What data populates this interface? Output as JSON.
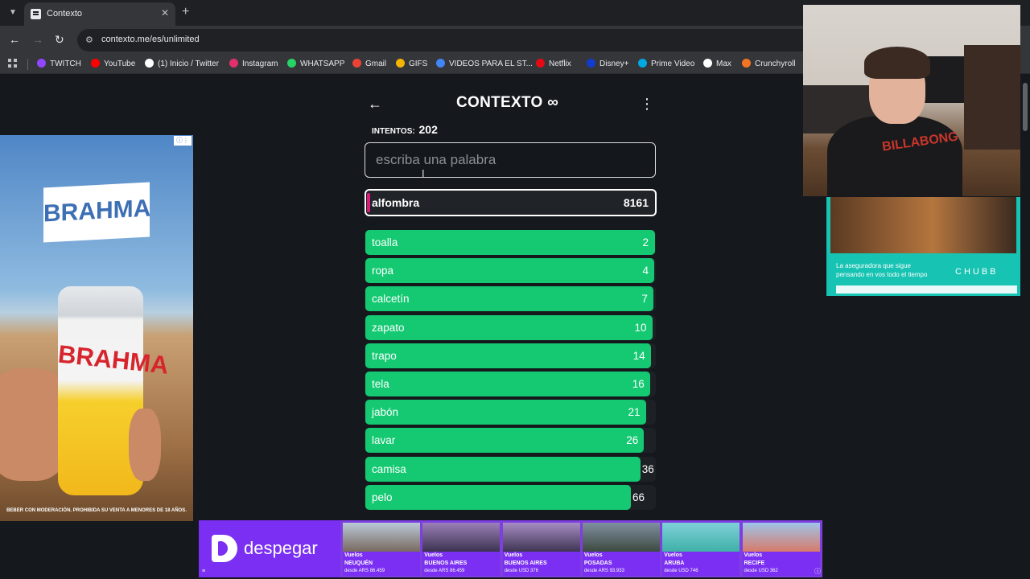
{
  "browser": {
    "tab_title": "Contexto",
    "url": "contexto.me/es/unlimited",
    "bookmarks": [
      {
        "label": "TWITCH",
        "icon": "twitch-icon",
        "color": "#9146ff"
      },
      {
        "label": "YouTube",
        "icon": "youtube-icon",
        "color": "#ff0000"
      },
      {
        "label": "(1) Inicio / Twitter",
        "icon": "x-icon",
        "color": "#ffffff"
      },
      {
        "label": "Instagram",
        "icon": "instagram-icon",
        "color": "#e1306c"
      },
      {
        "label": "WHATSAPP",
        "icon": "whatsapp-icon",
        "color": "#25d366"
      },
      {
        "label": "Gmail",
        "icon": "gmail-icon",
        "color": "#ea4335"
      },
      {
        "label": "GIFS",
        "icon": "gifs-icon",
        "color": "#f4b400"
      },
      {
        "label": "VIDEOS PARA EL ST...",
        "icon": "drive-icon",
        "color": "#4285f4"
      },
      {
        "label": "Netflix",
        "icon": "netflix-icon",
        "color": "#e50914"
      },
      {
        "label": "Disney+",
        "icon": "disney-icon",
        "color": "#113ccf"
      },
      {
        "label": "Prime Video",
        "icon": "prime-video-icon",
        "color": "#00a8e1"
      },
      {
        "label": "Max",
        "icon": "max-icon",
        "color": "#ffffff"
      },
      {
        "label": "Crunchyroll",
        "icon": "crunchyroll-icon",
        "color": "#f47521"
      }
    ]
  },
  "game": {
    "logo": "CONTEXTO ∞",
    "attempts_label": "INTENTOS:",
    "attempts_count": "202",
    "input_placeholder": "escriba una palabra",
    "current_guess": {
      "word": "alfombra",
      "rank": "8161"
    },
    "accent_color": "#14c972",
    "guesses": [
      {
        "word": "toalla",
        "rank": 2
      },
      {
        "word": "ropa",
        "rank": 4
      },
      {
        "word": "calcetín",
        "rank": 7
      },
      {
        "word": "zapato",
        "rank": 10
      },
      {
        "word": "trapo",
        "rank": 14
      },
      {
        "word": "tela",
        "rank": 16
      },
      {
        "word": "jabón",
        "rank": 21
      },
      {
        "word": "lavar",
        "rank": 26
      },
      {
        "word": "camisa",
        "rank": 36
      },
      {
        "word": "pelo",
        "rank": 66
      }
    ]
  },
  "ads": {
    "left_brand": "BRAHMA",
    "left_can_text": "BRAHMA",
    "left_footer": "BEBER CON MODERACIÓN. PROHIBIDA SU VENTA A MENORES DE 18 AÑOS.",
    "right_text": "La aseguradora que sigue pensando en vos todo el tiempo",
    "right_brand": "CHUBB",
    "banner_brand": "despegar",
    "banner_offers": [
      {
        "label": "Vuelos",
        "city": "NEUQUÉN",
        "price": "desde ARS 86.459",
        "c1": "#b9c8d8",
        "c2": "#7a6a60"
      },
      {
        "label": "Vuelos",
        "city": "BUENOS AIRES",
        "price": "desde ARS 86.459",
        "c1": "#9a7fb8",
        "c2": "#3d3350"
      },
      {
        "label": "Vuelos",
        "city": "BUENOS AIRES",
        "price": "desde USD 376",
        "c1": "#a68cc4",
        "c2": "#3f3552"
      },
      {
        "label": "Vuelos",
        "city": "POSADAS",
        "price": "desde ARS 93.933",
        "c1": "#7f8fa0",
        "c2": "#3d4a40"
      },
      {
        "label": "Vuelos",
        "city": "ARUBA",
        "price": "desde USD 746",
        "c1": "#7fd0d8",
        "c2": "#3fb1a8"
      },
      {
        "label": "Vuelos",
        "city": "RECIFE",
        "price": "desde USD 362",
        "c1": "#9fc4e8",
        "c2": "#d77a6a"
      }
    ]
  },
  "webcam": {
    "shirt_text": "BILLABONG"
  }
}
